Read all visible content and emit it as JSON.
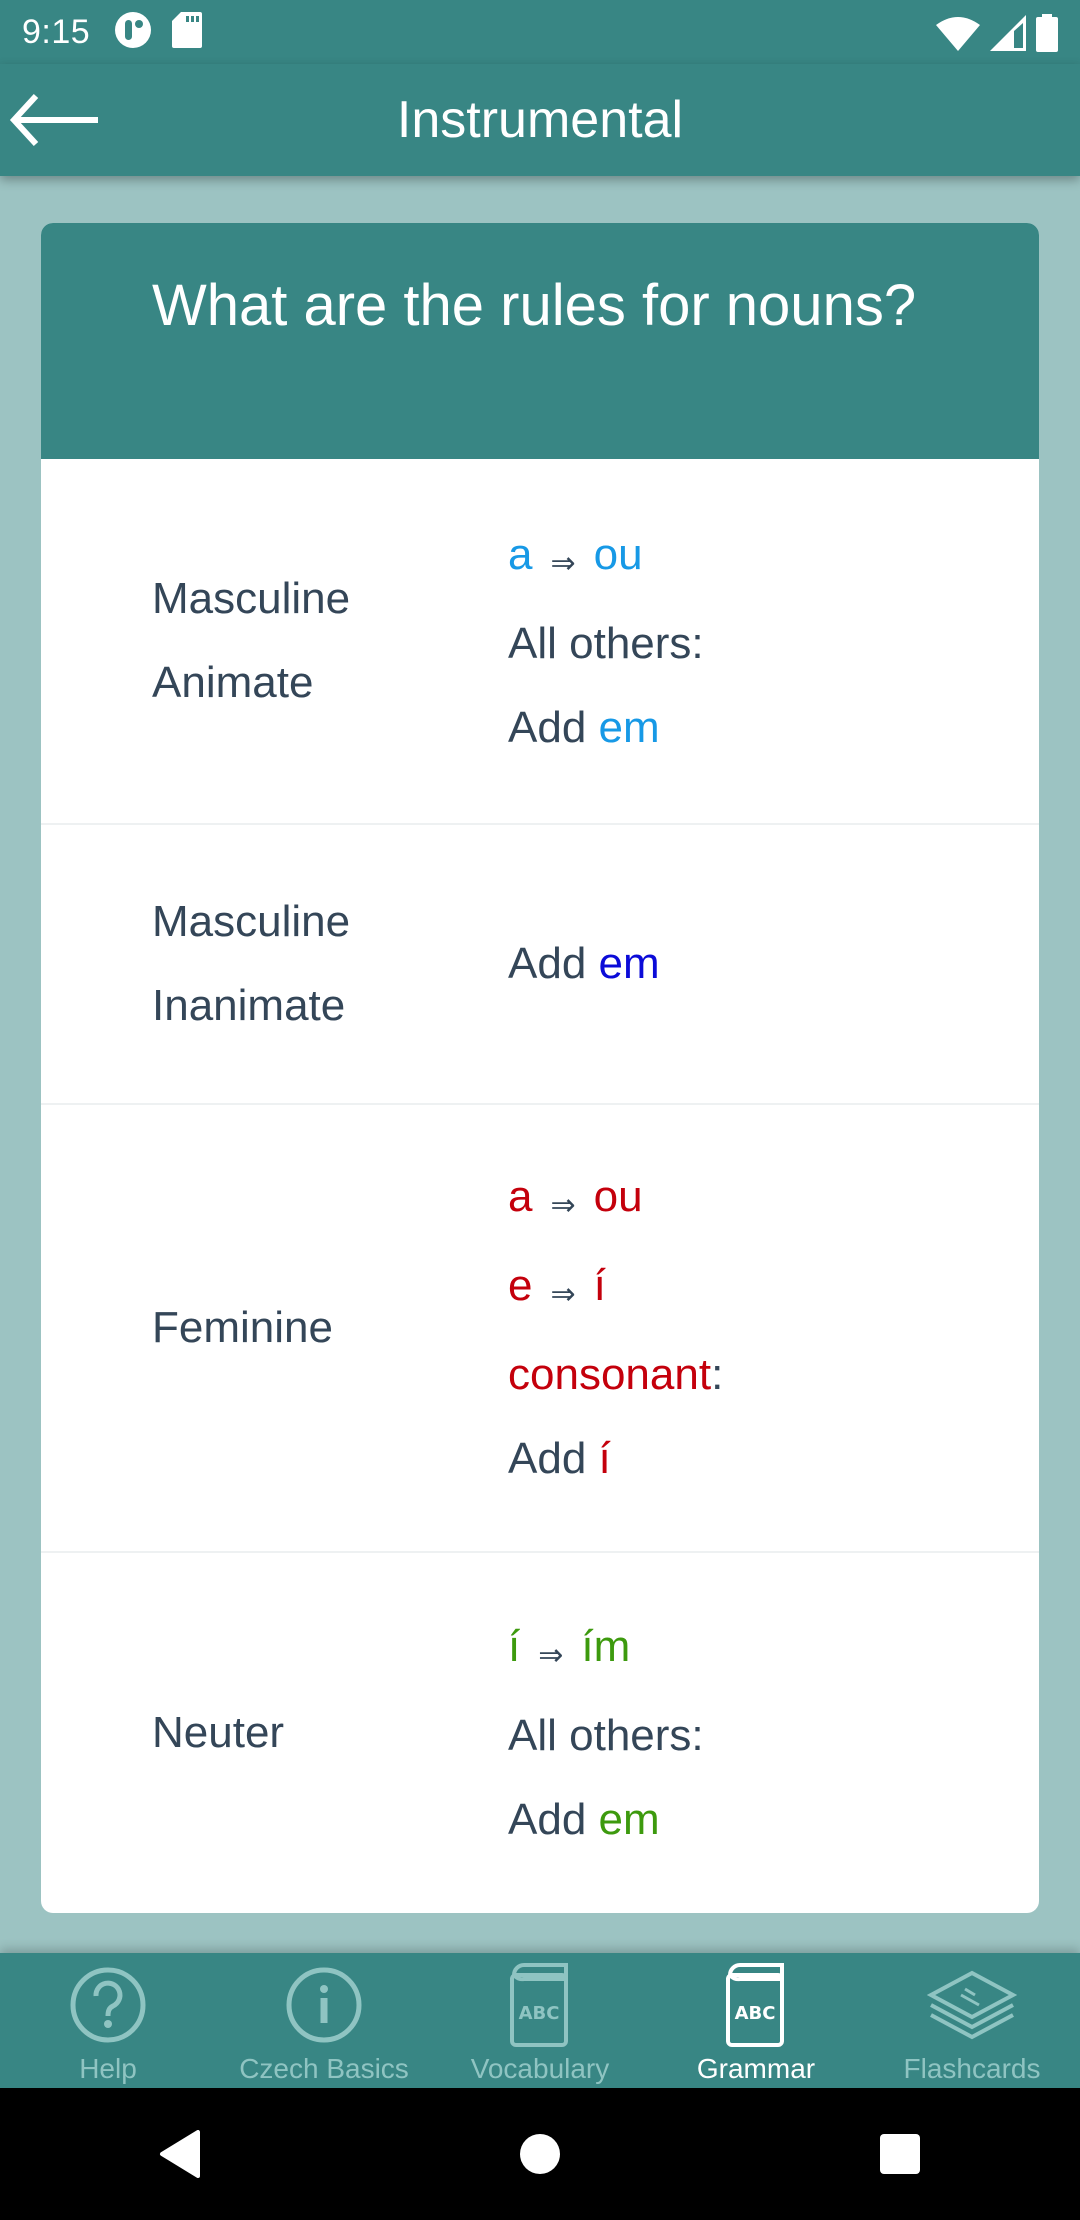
{
  "status_bar": {
    "time": "9:15",
    "left_icons": [
      "circle-notification-icon",
      "sd-card-icon"
    ],
    "right_icons": [
      "wifi-icon",
      "cell-signal-icon",
      "battery-icon"
    ]
  },
  "app_bar": {
    "title": "Instrumental",
    "back_icon": "arrow-left-icon"
  },
  "card": {
    "title": "What are the rules for nouns?",
    "rows": [
      {
        "label_lines": [
          "Masculine",
          "Animate"
        ],
        "rules": {
          "line1": {
            "from": "a",
            "arrow": "⇒",
            "to": "ou"
          },
          "line2": "All others:",
          "line3": {
            "prefix": "Add ",
            "ending": "em"
          }
        }
      },
      {
        "label_lines": [
          "Masculine",
          "Inanimate"
        ],
        "rules": {
          "line1": {
            "prefix": "Add ",
            "ending": "em"
          }
        }
      },
      {
        "label_lines": [
          "Feminine"
        ],
        "rules": {
          "line1": {
            "from": "a",
            "arrow": "⇒",
            "to": "ou"
          },
          "line2": {
            "from": "e",
            "arrow": "⇒",
            "to": "í"
          },
          "line3": {
            "word": "consonant",
            "colon": ":"
          },
          "line4": {
            "prefix": "Add ",
            "ending": "í"
          }
        }
      },
      {
        "label_lines": [
          "Neuter"
        ],
        "rules": {
          "line1": {
            "from": "í",
            "arrow": "⇒",
            "to": "ím"
          },
          "line2": "All others:",
          "line3": {
            "prefix": "Add ",
            "ending": "em"
          }
        }
      }
    ]
  },
  "colors": {
    "primary": "#388684",
    "background": "#9cc3c2",
    "text": "#344658",
    "masculine_animate": "#1799e6",
    "masculine_inanimate": "#0b0bd8",
    "feminine": "#c4000c",
    "neuter": "#3d9a0e",
    "nav_inactive": "#8fc4c2"
  },
  "bottom_nav": {
    "items": [
      {
        "label": "Help",
        "icon": "help-circle-icon",
        "active": false
      },
      {
        "label": "Czech Basics",
        "icon": "info-circle-icon",
        "active": false
      },
      {
        "label": "Vocabulary",
        "icon": "abc-book-icon",
        "active": false
      },
      {
        "label": "Grammar",
        "icon": "abc-book-icon",
        "active": true
      },
      {
        "label": "Flashcards",
        "icon": "stacked-cards-icon",
        "active": false
      }
    ]
  },
  "system_nav": [
    "back-triangle-icon",
    "home-circle-icon",
    "recents-square-icon"
  ]
}
